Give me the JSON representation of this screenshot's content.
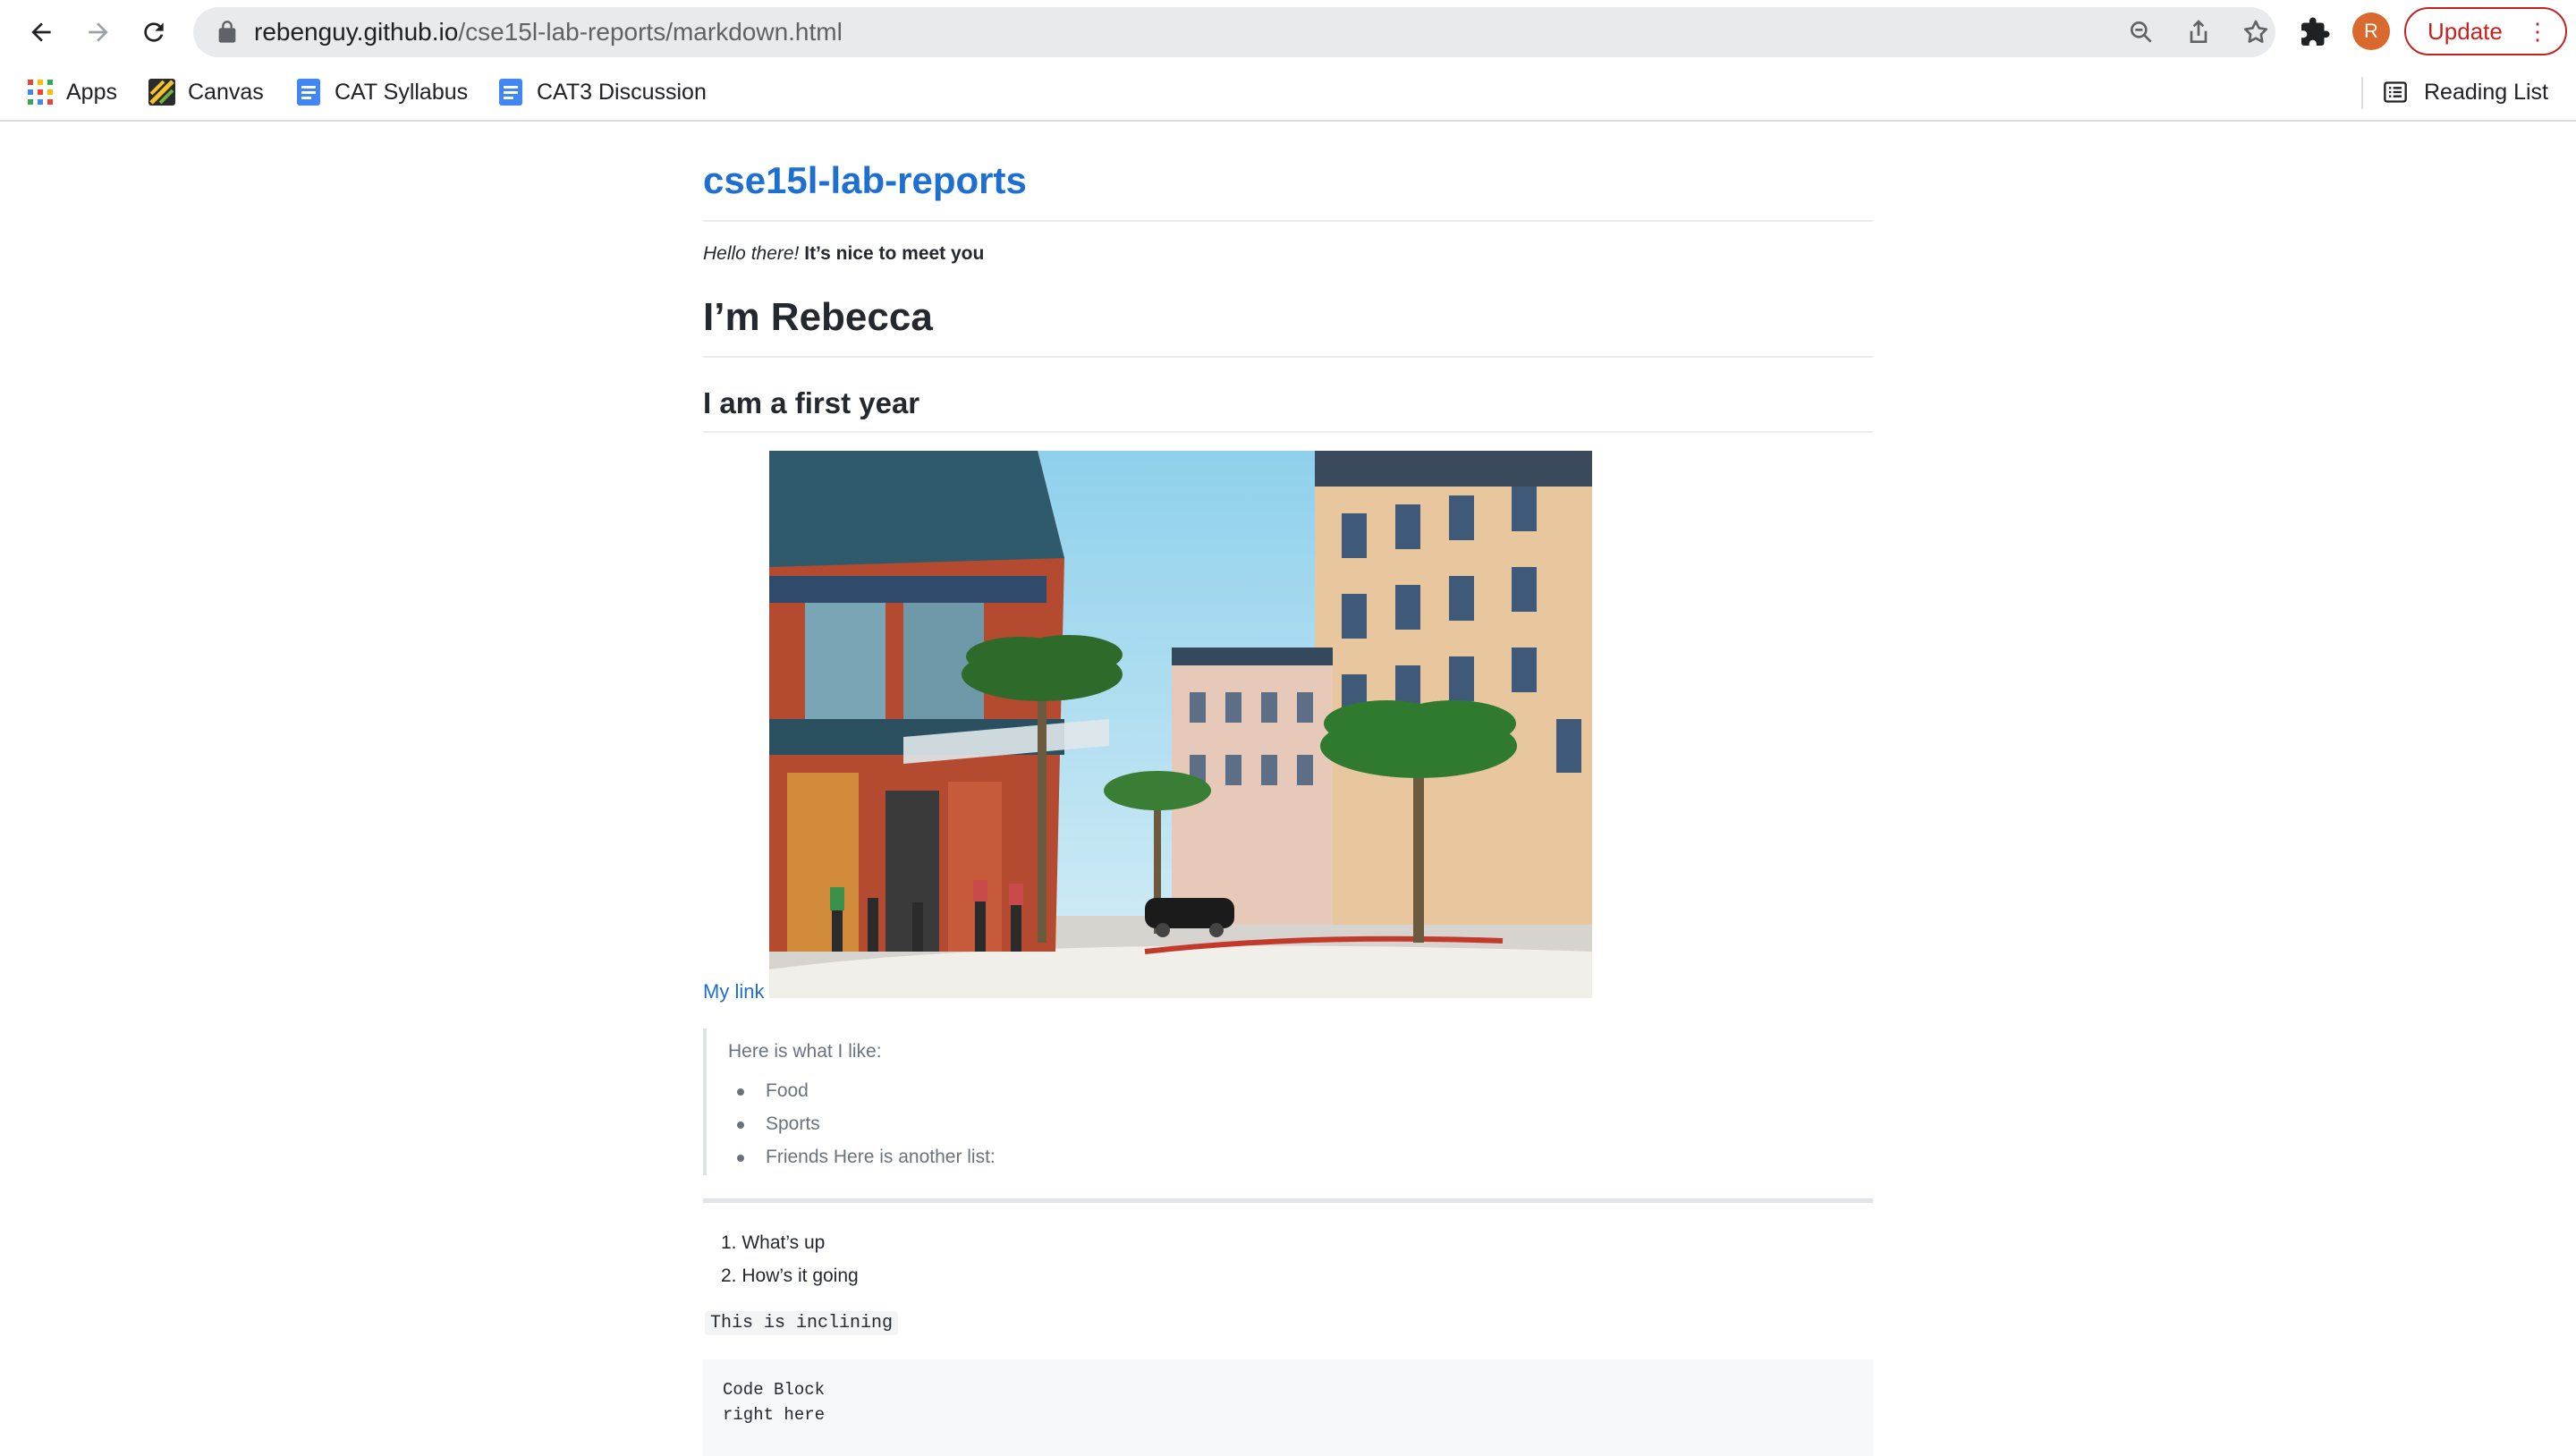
{
  "browser": {
    "url_host": "rebenguy.github.io",
    "url_path": "/cse15l-lab-reports/markdown.html",
    "profile_initial": "R",
    "update_label": "Update",
    "bookmarks": [
      {
        "label": "Apps",
        "icon": "apps-grid-icon"
      },
      {
        "label": "Canvas",
        "icon": "canvas-icon"
      },
      {
        "label": "CAT Syllabus",
        "icon": "google-doc-icon"
      },
      {
        "label": "CAT3 Discussion",
        "icon": "google-doc-icon"
      }
    ],
    "reading_list_label": "Reading List"
  },
  "page": {
    "site_title": "cse15l-lab-reports",
    "intro_italic": "Hello there!",
    "intro_bold": "It’s nice to meet you",
    "heading1": "I’m Rebecca",
    "heading2": "I am a first year",
    "link_text": "My link",
    "image_subject": "street scene with palm trees and buildings",
    "blockquote_text": "Here is what I like:",
    "likes": [
      "Food",
      "Sports",
      "Friends Here is another list:"
    ],
    "ordered": [
      "1. What’s up",
      "2. How’s it going"
    ],
    "inline_code": "This is inclining",
    "code_block": [
      "Code Block",
      "right here"
    ]
  },
  "colors": {
    "link": "#1f6fd1",
    "update": "#c5221f",
    "avatar": "#d9692d"
  }
}
